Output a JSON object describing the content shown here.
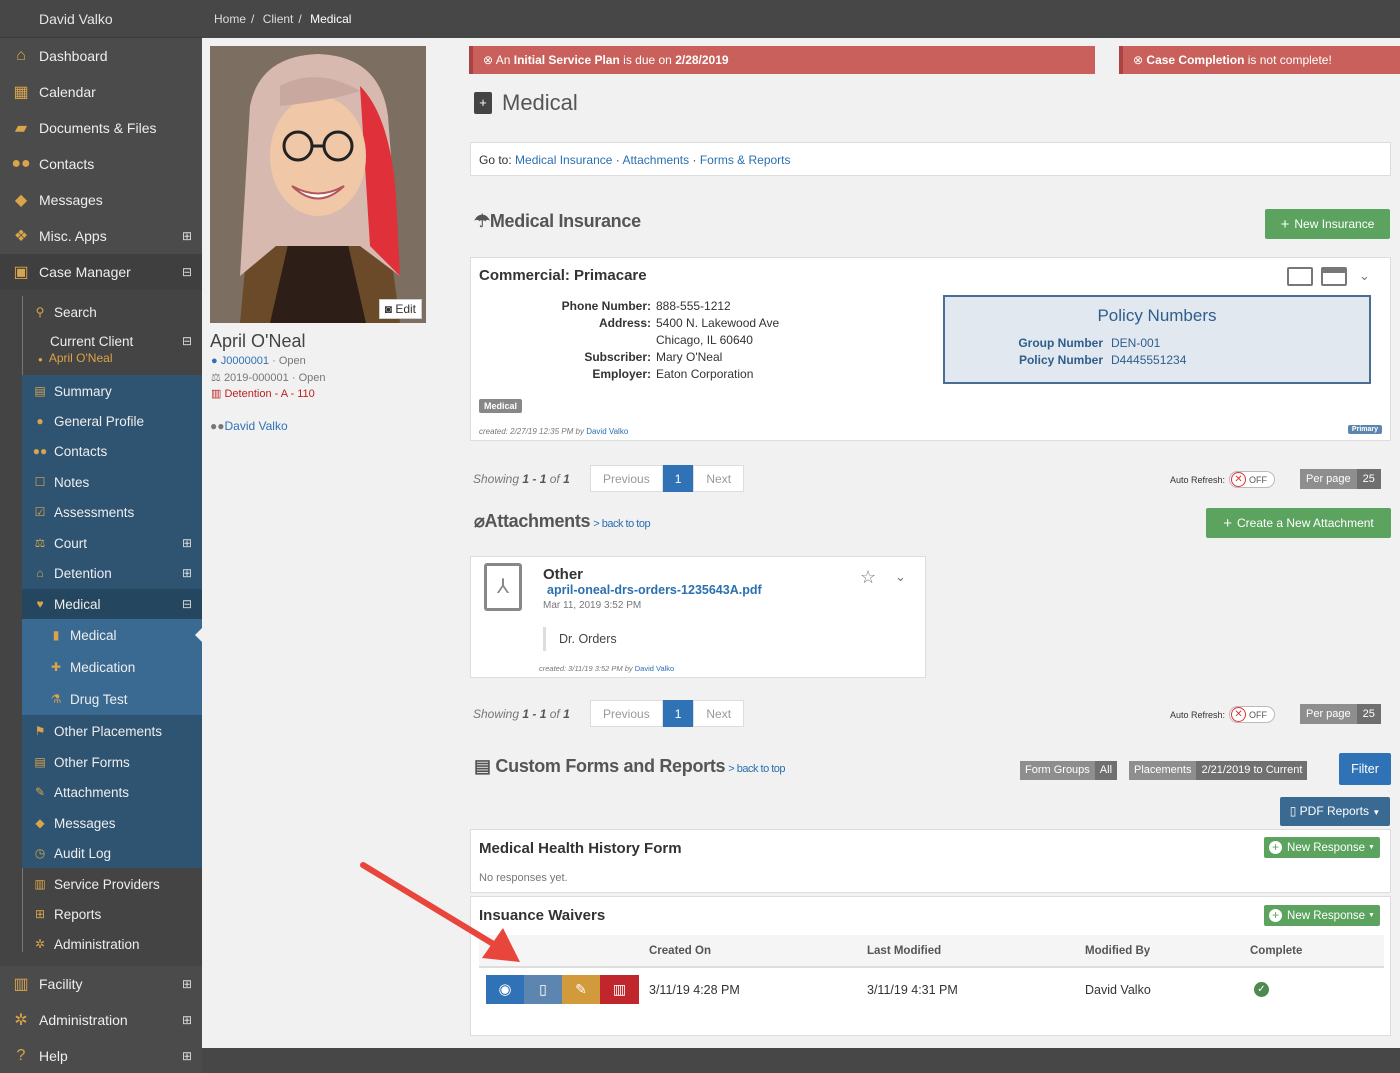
{
  "sidebar": {
    "user": "David Valko",
    "items": [
      {
        "label": "Dashboard",
        "icon": "home-icon"
      },
      {
        "label": "Calendar",
        "icon": "calendar-icon"
      },
      {
        "label": "Documents & Files",
        "icon": "folder-icon"
      },
      {
        "label": "Contacts",
        "icon": "users-icon"
      },
      {
        "label": "Messages",
        "icon": "comments-icon"
      },
      {
        "label": "Misc. Apps",
        "icon": "cubes-icon",
        "toggle": "⊞"
      },
      {
        "label": "Case Manager",
        "icon": "briefcase-icon",
        "toggle": "⊟"
      }
    ],
    "case_manager": {
      "search": "Search",
      "current_client": "Current Client",
      "current_client_toggle": "⊟",
      "client_name": "April O'Neal",
      "summary": "Summary",
      "general_profile": "General Profile",
      "contacts": "Contacts",
      "notes": "Notes",
      "assessments": "Assessments",
      "court": "Court",
      "court_toggle": "⊞",
      "detention": "Detention",
      "detention_toggle": "⊞",
      "medical": "Medical",
      "medical_toggle": "⊟",
      "medical_sub": "Medical",
      "medication": "Medication",
      "drug_test": "Drug Test",
      "other_placements": "Other Placements",
      "other_forms": "Other Forms",
      "attachments": "Attachments",
      "messages": "Messages",
      "audit_log": "Audit Log",
      "service_providers": "Service Providers",
      "reports": "Reports",
      "administration": "Administration"
    },
    "bottom": [
      {
        "label": "Facility",
        "icon": "building-icon",
        "toggle": "⊞"
      },
      {
        "label": "Administration",
        "icon": "cogs-icon",
        "toggle": "⊞"
      },
      {
        "label": "Help",
        "icon": "help-icon",
        "toggle": "⊞"
      }
    ]
  },
  "breadcrumb": {
    "home": "Home",
    "client": "Client",
    "current": "Medical",
    "sep": "/"
  },
  "profile": {
    "edit": "Edit",
    "name": "April O'Neal",
    "case_id": "J0000001",
    "case_status": "· Open",
    "court_id": "2019-000001",
    "court_status": "· Open",
    "detention": "Detention - A - 110",
    "worker": "David Valko"
  },
  "alerts": {
    "left_pre": "An ",
    "left_bold": "Initial Service Plan",
    "left_mid": " is due on ",
    "left_date": "2/28/2019",
    "right_bold": "Case Completion",
    "right_rest": " is not complete!"
  },
  "page_title": "Medical",
  "goto": {
    "label": "Go to:",
    "links": [
      "Medical Insurance",
      "Attachments",
      "Forms & Reports"
    ],
    "sep": "·"
  },
  "insurance": {
    "title": "Medical Insurance",
    "new_button": "New Insurance",
    "card_title": "Commercial: Primacare",
    "fields": [
      {
        "label": "Phone Number:",
        "value": "888-555-1212"
      },
      {
        "label": "Address:",
        "value": "5400 N. Lakewood Ave"
      },
      {
        "label": "",
        "value": "Chicago, IL 60640"
      },
      {
        "label": "Subscriber:",
        "value": "Mary O'Neal"
      },
      {
        "label": "Employer:",
        "value": "Eaton Corporation"
      }
    ],
    "policy_title": "Policy Numbers",
    "group_label": "Group Number",
    "group_value": "DEN-001",
    "policy_label": "Policy Number",
    "policy_value": "D4445551234",
    "tag": "Medical",
    "created_pre": "created: 2/27/19 12:35 PM by ",
    "created_by": "David Valko",
    "primary": "Primary"
  },
  "pager": {
    "showing": "Showing",
    "range": "1 - 1",
    "of": "of",
    "total": "1",
    "prev": "Previous",
    "page": "1",
    "next": "Next",
    "auto_refresh": "Auto Refresh:",
    "off": "OFF",
    "per_page": "Per page",
    "per_page_value": "25"
  },
  "attachments": {
    "title": "Attachments",
    "back": "> back to top",
    "create_button": "Create a New Attachment",
    "item_title": "Other",
    "file": "april-oneal-drs-orders-1235643A.pdf",
    "date": "Mar 11, 2019 3:52 PM",
    "note": "Dr. Orders",
    "created_pre": "created: 3/11/19 3:52 PM by ",
    "created_by": "David Valko"
  },
  "forms": {
    "title": "Custom Forms and Reports",
    "back": "> back to top",
    "form_groups": "Form Groups",
    "form_groups_value": "All",
    "placements": "Placements",
    "placements_value": "2/21/2019 to Current",
    "filter": "Filter",
    "pdf_reports": "PDF Reports",
    "health_form": "Medical Health History Form",
    "new_response": "New Response",
    "no_responses": "No responses yet.",
    "waivers": "Insuance Waivers",
    "headers": [
      "Created On",
      "Last Modified",
      "Modified By",
      "Complete"
    ],
    "row": {
      "created": "3/11/19 4:28 PM",
      "modified": "3/11/19 4:31 PM",
      "by": "David Valko"
    }
  },
  "colors": {
    "sidebar": "#4b4b4b",
    "submenu": "#2f5472",
    "alert": "#c9605b",
    "green": "#5ba35f",
    "blue": "#2f72b6",
    "arrow": "#e8453c"
  }
}
